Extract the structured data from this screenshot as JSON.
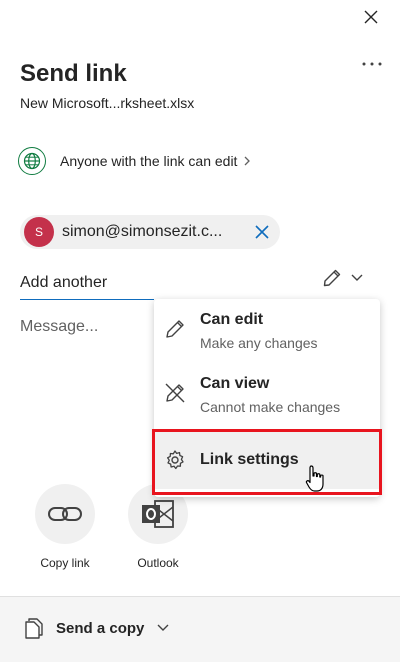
{
  "header": {
    "title": "Send link",
    "filename": "New Microsoft...rksheet.xlsx"
  },
  "link_scope": {
    "label": "Anyone with the link can edit"
  },
  "recipients": [
    {
      "initial": "S",
      "email": "simon@simonsezit.c..."
    }
  ],
  "add_field": {
    "value": "",
    "placeholder": "Add another"
  },
  "message_field": {
    "value": "",
    "placeholder": "Message..."
  },
  "permission_menu": {
    "items": [
      {
        "title": "Can edit",
        "subtitle": "Make any changes",
        "icon": "pencil-icon"
      },
      {
        "title": "Can view",
        "subtitle": "Cannot make changes",
        "icon": "pencil-off-icon"
      },
      {
        "title": "Link settings",
        "icon": "gear-icon"
      }
    ],
    "highlight_color": "#e8141e"
  },
  "share_targets": [
    {
      "label": "Copy link",
      "icon": "link-icon"
    },
    {
      "label": "Outlook",
      "icon": "outlook-icon"
    }
  ],
  "footer": {
    "send_copy_label": "Send a copy"
  },
  "colors": {
    "accent": "#0f6cbd",
    "avatar": "#c4314b",
    "globe": "#107c41",
    "highlight": "#e8141e"
  }
}
